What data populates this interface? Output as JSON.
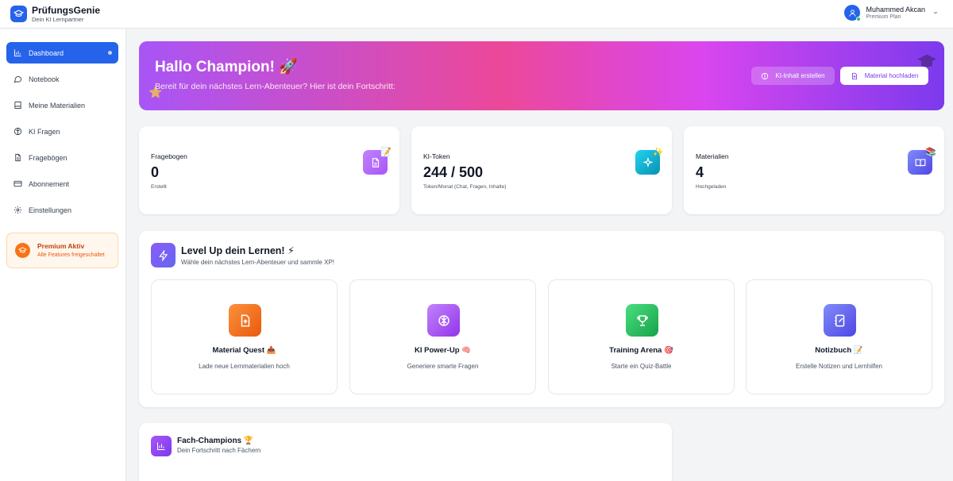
{
  "brand": {
    "name": "PrüfungsGenie",
    "tagline": "Dein KI Lernpartner"
  },
  "user": {
    "name": "Muhammed Akcan",
    "plan": "Premium Plan"
  },
  "sidebar": {
    "items": [
      {
        "label": "Dashboard",
        "icon": "bar-chart-icon",
        "active": true
      },
      {
        "label": "Notebook",
        "icon": "chat-bubble-icon"
      },
      {
        "label": "Meine Materialien",
        "icon": "book-icon"
      },
      {
        "label": "KI Fragen",
        "icon": "brain-icon"
      },
      {
        "label": "Fragebögen",
        "icon": "document-icon"
      },
      {
        "label": "Abonnement",
        "icon": "credit-card-icon"
      },
      {
        "label": "Einstellungen",
        "icon": "gear-icon"
      }
    ],
    "premium": {
      "title": "Premium Aktiv",
      "subtitle": "Alle Features freigeschaltet"
    }
  },
  "hero": {
    "title": "Hallo Champion! 🚀",
    "subtitle": "Bereit für dein nächstes Lern-Abenteuer? Hier ist dein Fortschritt:",
    "button_ai": "KI-Inhalt erstellen",
    "button_upload": "Material hochladen"
  },
  "stats": [
    {
      "label": "Fragebogen",
      "value": "0",
      "note": "Erstellt",
      "icon": "document-icon",
      "emoji": "📝",
      "color": "#a855f7"
    },
    {
      "label": "KI-Token",
      "value": "244 / 500",
      "note": "Token/Monat (Chat, Fragen, Inhalte)",
      "icon": "sparkles-icon",
      "emoji": "✨",
      "color": "#0ea5e9"
    },
    {
      "label": "Materialien",
      "value": "4",
      "note": "Hochgeladen",
      "icon": "open-book-icon",
      "emoji": "📚",
      "color": "#6366f1"
    }
  ],
  "levelup": {
    "title": "Level Up dein Lernen! ⚡",
    "subtitle": "Wähle dein nächstes Lern-Abenteuer und sammle XP!",
    "cards": [
      {
        "title": "Material Quest 📤",
        "desc": "Lade neue Lernmaterialien hoch",
        "icon": "upload-file-icon",
        "color": "#f97316"
      },
      {
        "title": "KI Power-Up 🧠",
        "desc": "Generiere smarte Fragen",
        "icon": "brain-icon",
        "color": "#a855f7"
      },
      {
        "title": "Training Arena 🎯",
        "desc": "Starte ein Quiz-Battle",
        "icon": "trophy-icon",
        "color": "#22c55e"
      },
      {
        "title": "Notizbuch 📝",
        "desc": "Erstelle Notizen und Lernhilfen",
        "icon": "notebook-pen-icon",
        "color": "#6366f1"
      }
    ]
  },
  "champions": {
    "title": "Fach-Champions 🏆",
    "subtitle": "Dein Fortschritt nach Fächern"
  }
}
